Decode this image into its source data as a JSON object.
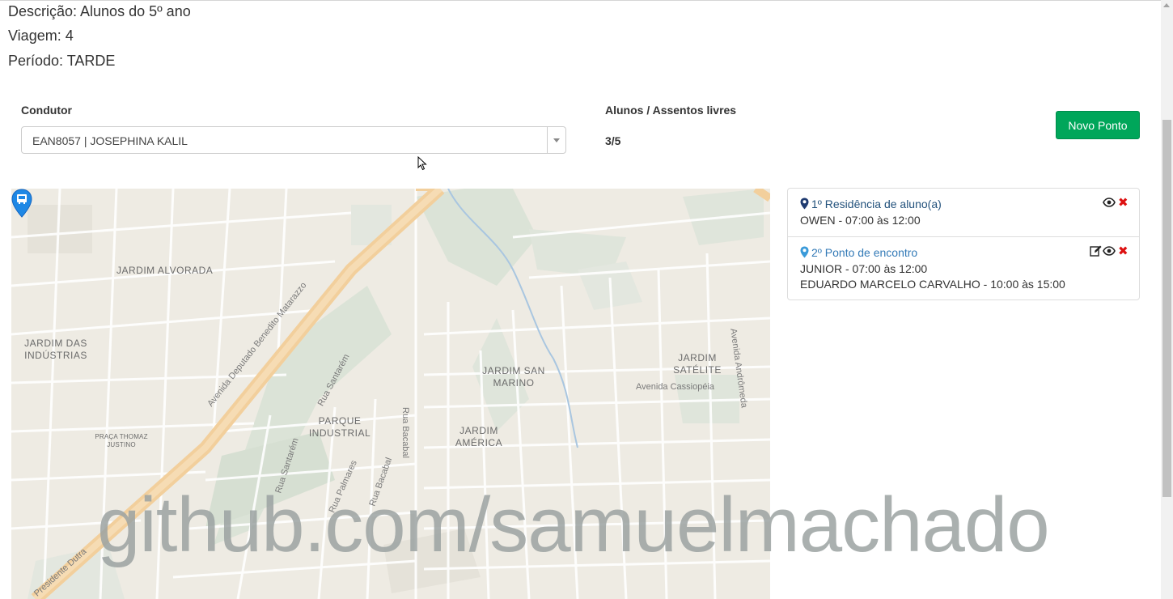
{
  "header": {
    "descricao": "Descrição: Alunos do 5º ano",
    "viagem": "Viagem: 4",
    "periodo": "Período: TARDE"
  },
  "form": {
    "condutor_label": "Condutor",
    "condutor_value": "EAN8057 | JOSEPHINA KALIL",
    "alunos_label": "Alunos / Assentos livres",
    "alunos_value": "3/5",
    "novo_ponto_label": "Novo Ponto"
  },
  "map": {
    "labels": {
      "alvorada": "JARDIM ALVORADA",
      "industrias": "JARDIM DAS INDÚSTRIAS",
      "parque": "PARQUE INDUSTRIAL",
      "sanmarino": "JARDIM SAN MARINO",
      "america": "JARDIM AMÉRICA",
      "satelite": "JARDIM SATÉLITE",
      "praca": "PRAÇA THOMAZ JUSTINO"
    },
    "streets": {
      "mataraz": "Avenida Deputado Benedito Matarazzo",
      "santarem1": "Rua Santarém",
      "bacabal1": "Rua Bacabal",
      "cassiopeia": "Avenida Cassiopéia",
      "andromeda": "Avenida Andrômeda",
      "santarem2": "Rua Santarém",
      "palmares": "Rua Palmares",
      "bacabal2": "Rua Bacabal",
      "dutra": "Presidente Dutra"
    }
  },
  "points": [
    {
      "title": "1º Residência de aluno(a)",
      "lines": [
        "OWEN - 07:00 às 12:00"
      ],
      "icon_color": "#1f3b70"
    },
    {
      "title": "2º Ponto de encontro",
      "lines": [
        "JUNIOR - 07:00 às 12:00",
        "EDUARDO MARCELO CARVALHO - 10:00 às 15:00"
      ],
      "icon_color": "#3a9ad9"
    }
  ],
  "icons": {
    "map_pin": "map-pin-icon",
    "view": "eye-icon",
    "edit": "edit-icon",
    "delete": "close-icon"
  },
  "watermark": "github.com/samuelmachado",
  "colors": {
    "accent_green": "#00a65a",
    "delete_red": "#dd1111",
    "link_blue": "#337ab7"
  }
}
